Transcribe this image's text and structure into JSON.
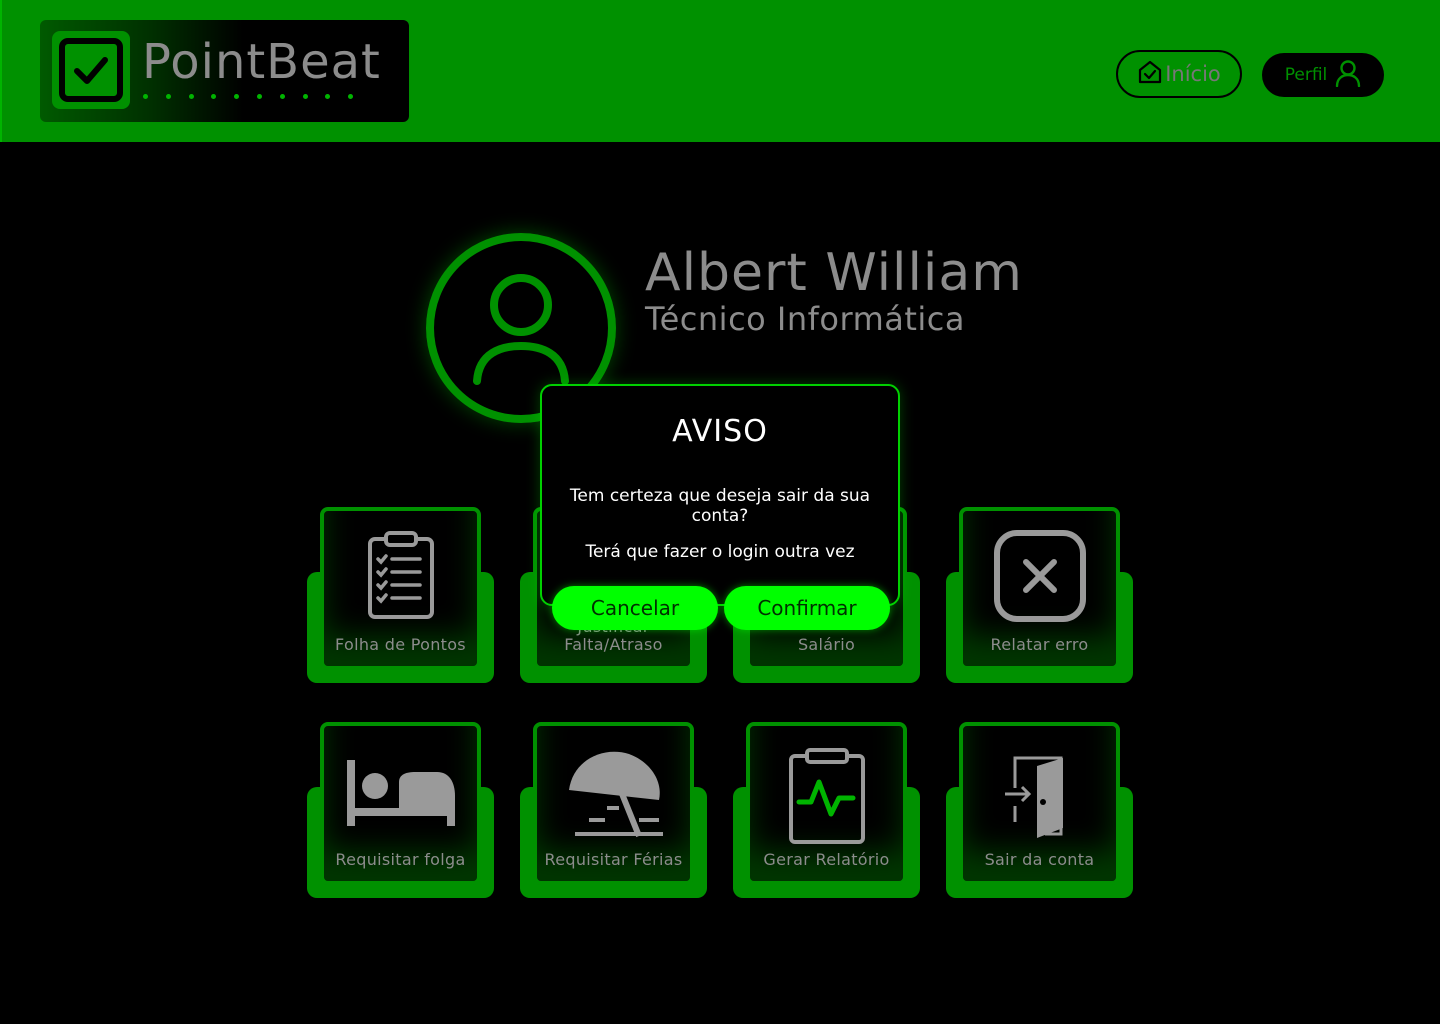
{
  "app": {
    "logo_text": "PointBeat"
  },
  "header": {
    "inicio_label": "Início",
    "perfil_label": "Perfil"
  },
  "profile": {
    "name": "Albert William",
    "role": "Técnico Informática"
  },
  "cards": [
    {
      "label": "Folha de Pontos",
      "icon": "clipboard-list-icon"
    },
    {
      "label": "Justificar Falta/Atraso",
      "icon": "document-icon"
    },
    {
      "label": "Salário",
      "icon": "money-icon"
    },
    {
      "label": "Relatar erro",
      "icon": "close-box-icon"
    },
    {
      "label": "Requisitar folga",
      "icon": "bed-icon"
    },
    {
      "label": "Requisitar Férias",
      "icon": "beach-umbrella-icon"
    },
    {
      "label": "Gerar Relatório",
      "icon": "clipboard-pulse-icon"
    },
    {
      "label": "Sair da conta",
      "icon": "door-exit-icon"
    }
  ],
  "modal": {
    "title": "AVISO",
    "message": "Tem certeza que deseja sair da sua conta?",
    "message2": "Terá que fazer o login outra vez",
    "cancel_label": "Cancelar",
    "confirm_label": "Confirmar"
  },
  "colors": {
    "brand_green": "#009100",
    "accent_green": "#00ff00",
    "text_gray": "#8c8c8c",
    "background": "#000000"
  }
}
